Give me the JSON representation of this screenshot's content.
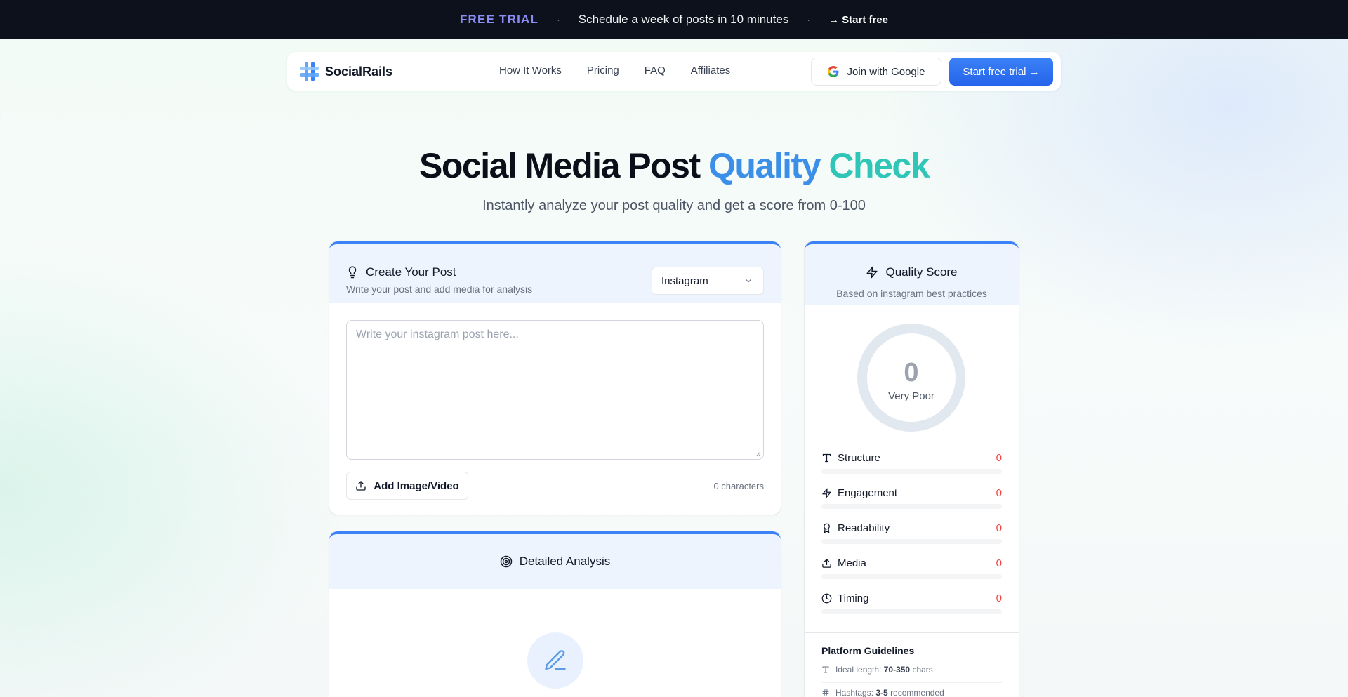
{
  "banner": {
    "tag": "FREE TRIAL",
    "separator": "·",
    "message": "Schedule a week of posts in 10 minutes",
    "cta": "→ Start free"
  },
  "nav": {
    "brand": "SocialRails",
    "links": [
      "How It Works",
      "Pricing",
      "FAQ",
      "Affiliates"
    ],
    "google_button": "Join with Google",
    "trial_button": "Start free trial →"
  },
  "hero": {
    "title_main": "Social Media Post",
    "title_accent_1": "Quality",
    "title_accent_2": "Check",
    "subtitle": "Instantly analyze your post quality and get a score from 0-100"
  },
  "create": {
    "title": "Create Your Post",
    "subtitle": "Write your post and add media for analysis",
    "platform_selected": "Instagram",
    "textarea_placeholder": "Write your instagram post here...",
    "add_media_button": "Add Image/Video",
    "char_count": "0 characters"
  },
  "analysis": {
    "title": "Detailed Analysis"
  },
  "score": {
    "title": "Quality Score",
    "subtitle": "Based on instagram best practices",
    "value": "0",
    "rating": "Very Poor",
    "metrics": [
      {
        "label": "Structure",
        "value": "0",
        "icon": "type-icon",
        "fill": 0
      },
      {
        "label": "Engagement",
        "value": "0",
        "icon": "zap-icon",
        "fill": 0
      },
      {
        "label": "Readability",
        "value": "0",
        "icon": "award-icon",
        "fill": 0
      },
      {
        "label": "Media",
        "value": "0",
        "icon": "upload-icon",
        "fill": 0
      },
      {
        "label": "Timing",
        "value": "0",
        "icon": "clock-icon",
        "fill": 0
      }
    ],
    "guidelines_title": "Platform Guidelines",
    "guidelines": [
      {
        "prefix": "Ideal length:",
        "value": "70-350",
        "suffix": "chars"
      },
      {
        "prefix": "Hashtags:",
        "value": "3-5",
        "suffix": "recommended"
      }
    ]
  },
  "colors": {
    "accent": "#3b82f6",
    "banner_bg": "#0d111b",
    "trial_tag": "#8b8df5",
    "score_red": "#ef4444"
  }
}
